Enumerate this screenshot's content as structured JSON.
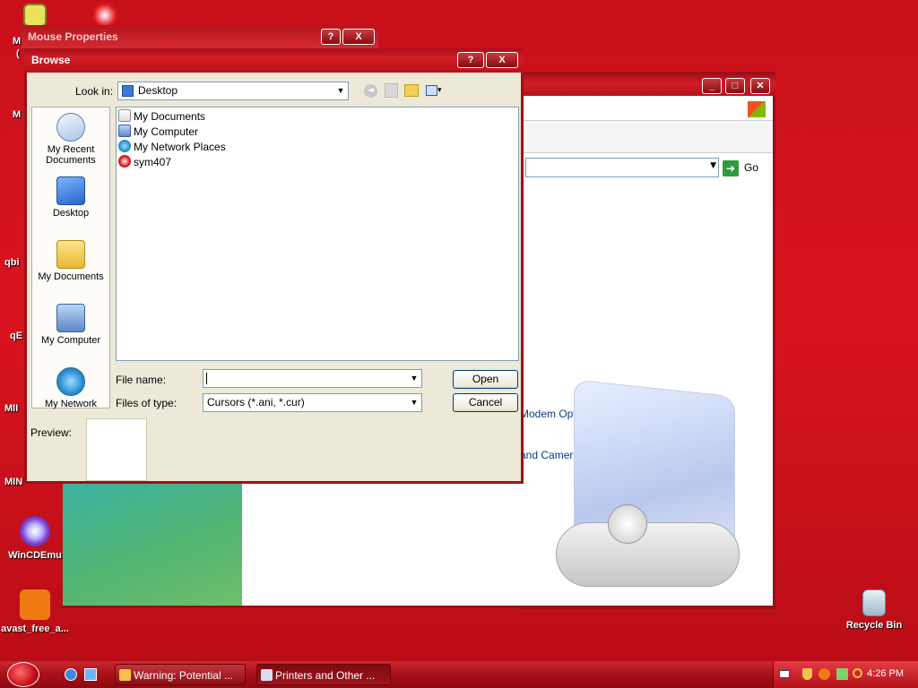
{
  "desktop": {
    "icons": [
      {
        "label": "WinCDEmu"
      },
      {
        "label": "avast_free_a..."
      },
      {
        "label": "Recycle Bin"
      }
    ],
    "cut_labels": [
      "M",
      "(",
      "M",
      "qbi",
      "qE",
      "MII",
      "MIN"
    ]
  },
  "mouse_properties": {
    "title": "Mouse Properties",
    "help": "?",
    "close": "X"
  },
  "control_panel": {
    "links": [
      "Modem Options",
      "and Cameras"
    ],
    "go_label": "Go"
  },
  "browse": {
    "title": "Browse",
    "help": "?",
    "close": "X",
    "look_in_label": "Look in:",
    "look_in_value": "Desktop",
    "places": [
      "My Recent Documents",
      "Desktop",
      "My Documents",
      "My Computer",
      "My Network"
    ],
    "files": [
      "My Documents",
      "My Computer",
      "My Network Places",
      "sym407"
    ],
    "file_name_label": "File name:",
    "file_name_value": "",
    "files_of_type_label": "Files of type:",
    "files_of_type_value": "Cursors (*.ani, *.cur)",
    "open_label": "Open",
    "cancel_label": "Cancel",
    "preview_label": "Preview:"
  },
  "taskbar": {
    "tasks": [
      "Warning: Potential ...",
      "Printers and Other ..."
    ],
    "clock": "4:26 PM"
  },
  "colors": {
    "theme_red": "#c8101a",
    "dialog_bg": "#ece9d8",
    "link_blue": "#0b3a8a"
  }
}
